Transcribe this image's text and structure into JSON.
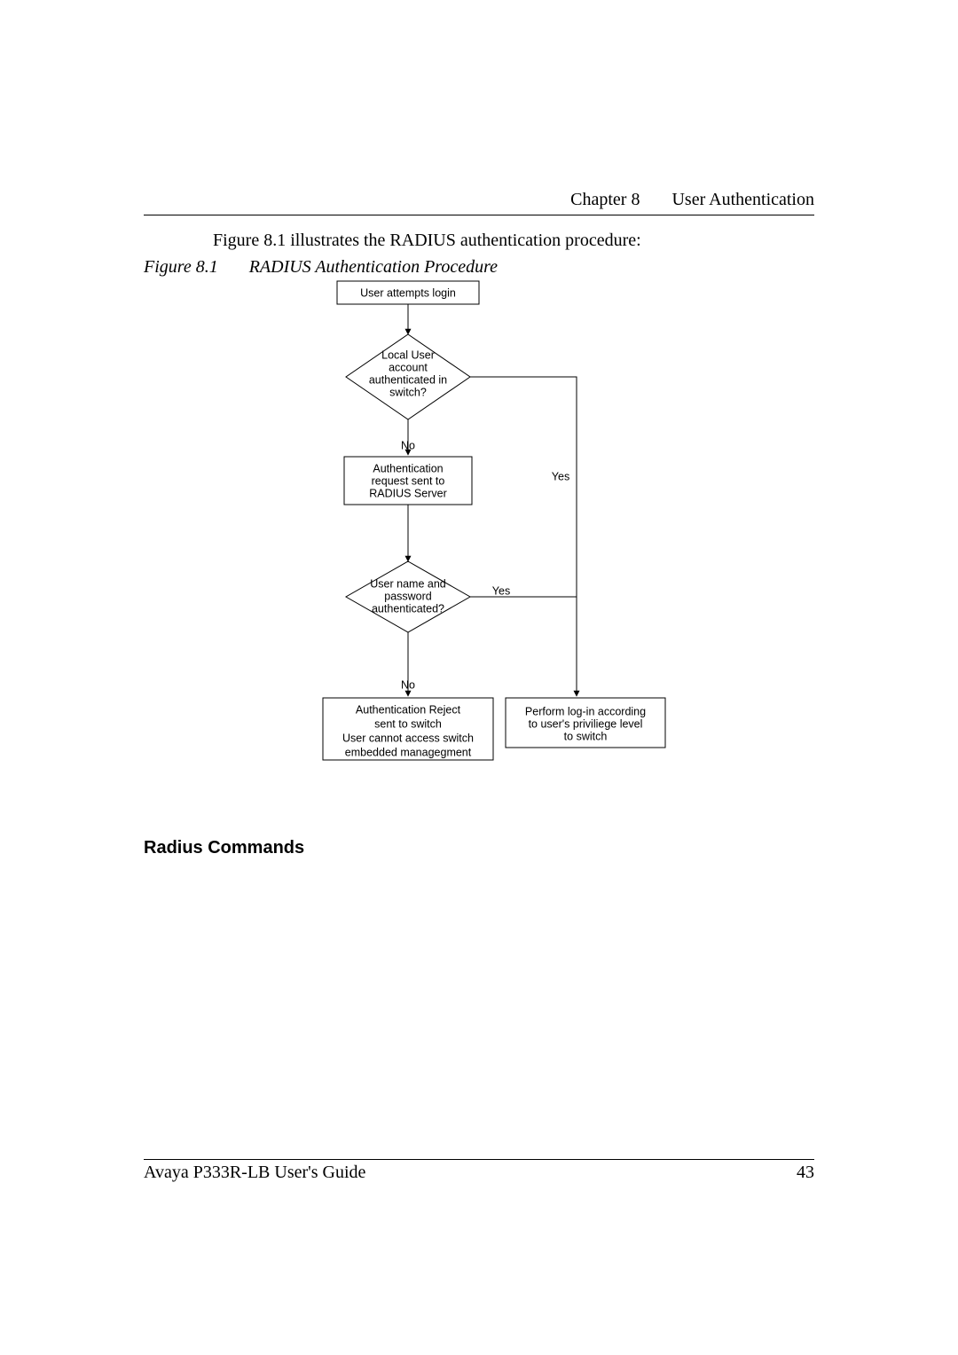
{
  "header": {
    "chapter": "Chapter 8",
    "title": "User Authentication"
  },
  "body": {
    "intro": "Figure 8.1 illustrates the RADIUS authentication procedure:",
    "figure_label": "Figure 8.1",
    "figure_title": "RADIUS Authentication Procedure"
  },
  "section_head": "Radius Commands",
  "footer": {
    "left": "Avaya P333R-LB User's Guide",
    "page": "43"
  },
  "chart_data": {
    "type": "flowchart",
    "nodes": {
      "start": {
        "shape": "rect",
        "lines": [
          "User attempts login"
        ]
      },
      "d1": {
        "shape": "diamond",
        "lines": [
          "Local User",
          "account",
          "authenticated in",
          "switch?"
        ]
      },
      "n1": {
        "shape": "rect",
        "lines": [
          "Authentication",
          "request sent to",
          "RADIUS Server"
        ]
      },
      "d2": {
        "shape": "diamond",
        "lines": [
          "User name and",
          "password",
          "authenticated?"
        ]
      },
      "reject": {
        "shape": "rect",
        "lines": [
          "Authentication Reject",
          "sent to switch",
          "User cannot access switch",
          "embedded managegment"
        ]
      },
      "accept": {
        "shape": "rect",
        "lines": [
          "Perform log-in according",
          "to user's priviliege level",
          "to switch"
        ]
      }
    },
    "edges": [
      {
        "from": "start",
        "to": "d1",
        "label": ""
      },
      {
        "from": "d1",
        "to": "n1",
        "label": "No"
      },
      {
        "from": "d1",
        "to": "accept",
        "label": "Yes"
      },
      {
        "from": "n1",
        "to": "d2",
        "label": ""
      },
      {
        "from": "d2",
        "to": "reject",
        "label": "No"
      },
      {
        "from": "d2",
        "to": "accept",
        "label": "Yes"
      }
    ]
  }
}
